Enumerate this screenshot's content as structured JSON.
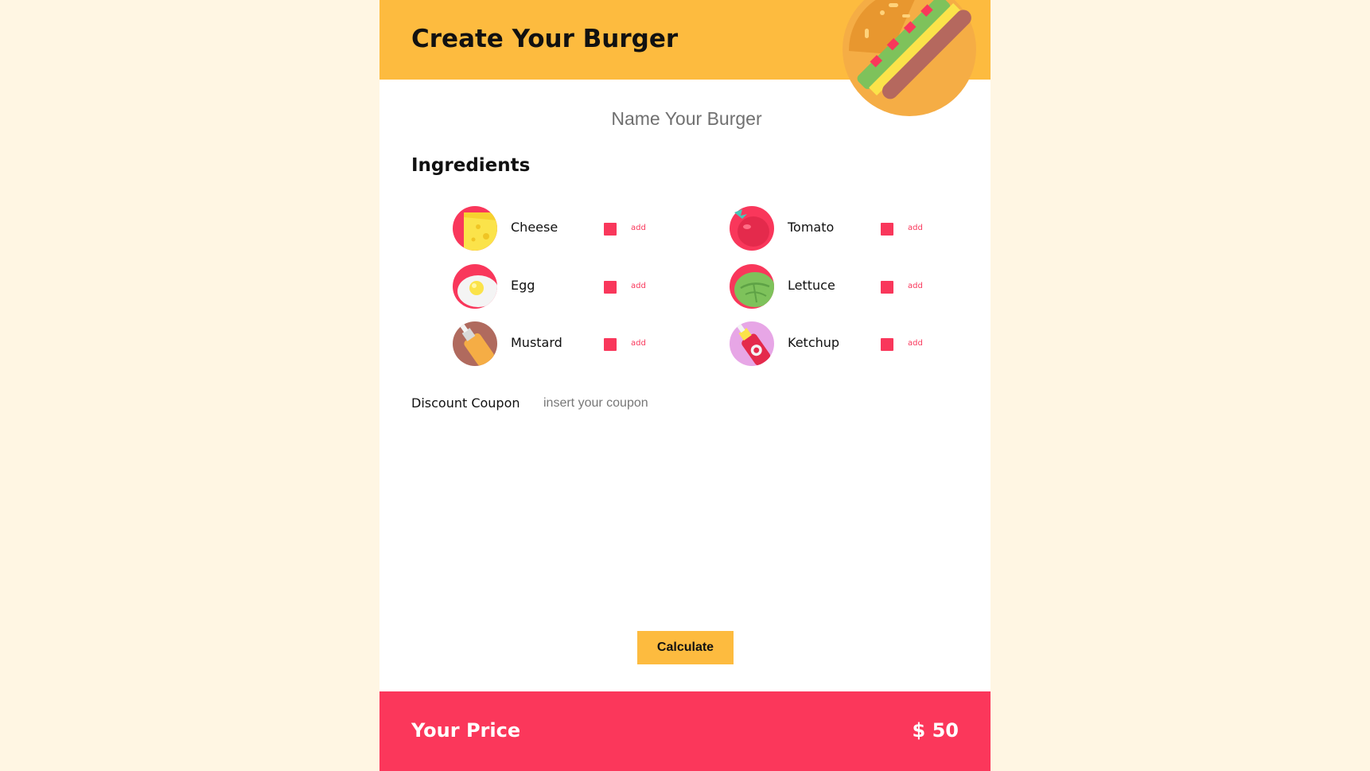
{
  "header": {
    "title": "Create Your Burger"
  },
  "burger_name": {
    "placeholder": "Name Your Burger",
    "value": ""
  },
  "ingredients": {
    "title": "Ingredients",
    "items": [
      {
        "name": "Cheese",
        "action": "add",
        "icon": "cheese-icon"
      },
      {
        "name": "Tomato",
        "action": "add",
        "icon": "tomato-icon"
      },
      {
        "name": "Egg",
        "action": "add",
        "icon": "egg-icon"
      },
      {
        "name": "Lettuce",
        "action": "add",
        "icon": "lettuce-icon"
      },
      {
        "name": "Mustard",
        "action": "add",
        "icon": "mustard-icon"
      },
      {
        "name": "Ketchup",
        "action": "add",
        "icon": "ketchup-icon"
      }
    ]
  },
  "coupon": {
    "label": "Discount Coupon",
    "placeholder": "insert your coupon",
    "value": ""
  },
  "actions": {
    "calculate_label": "Calculate"
  },
  "footer": {
    "price_label": "Your Price",
    "price_value": "$ 50"
  },
  "colors": {
    "background": "#fff6e3",
    "header": "#fdbb3f",
    "accent": "#fb375b",
    "button": "#fdbb3f"
  }
}
